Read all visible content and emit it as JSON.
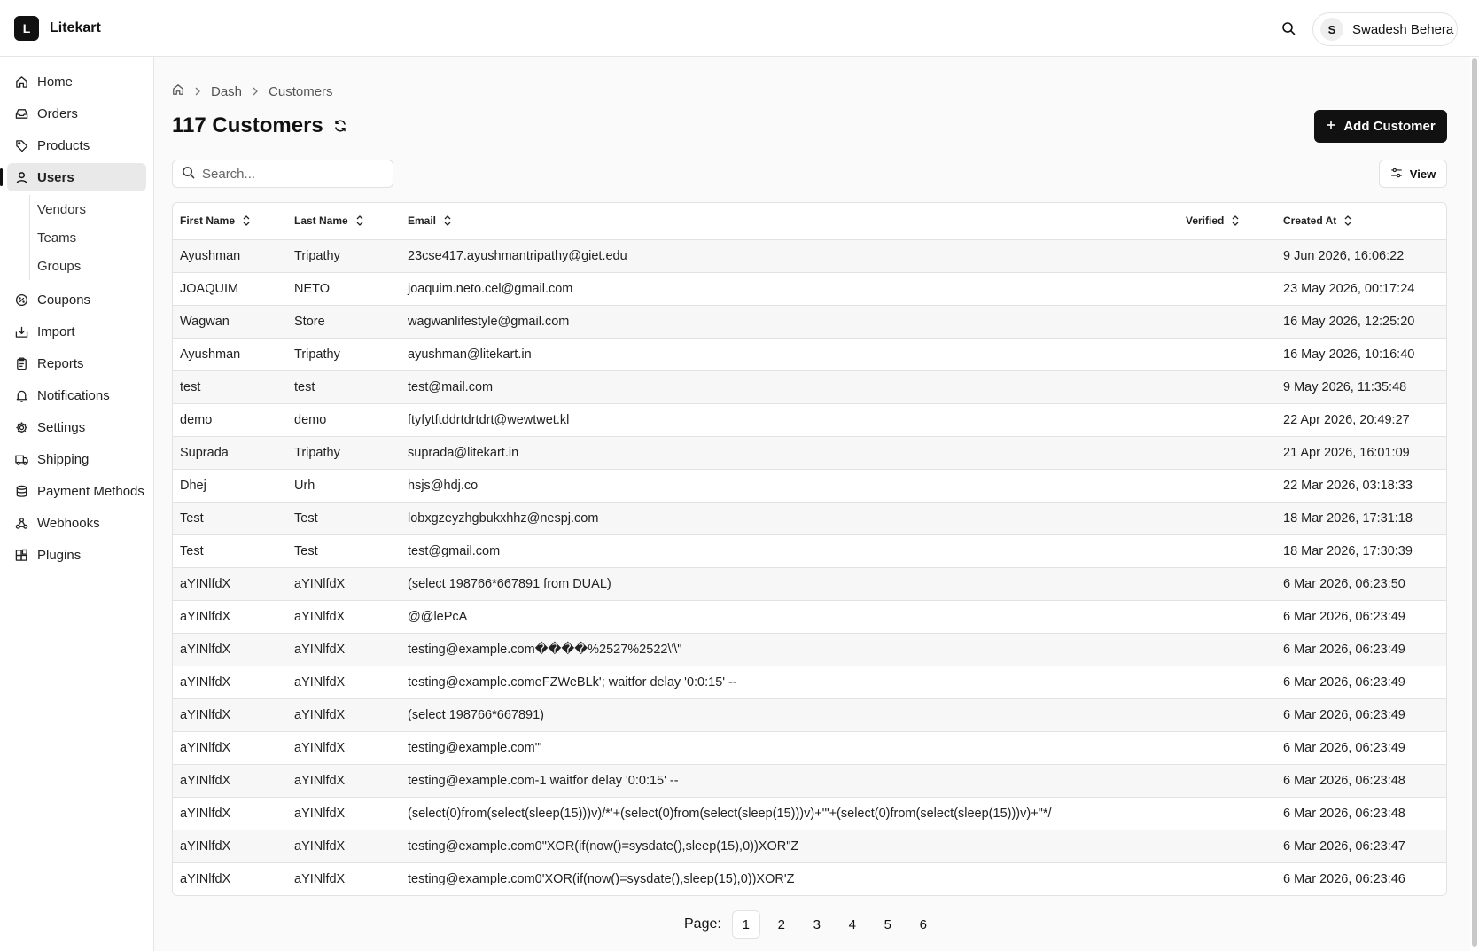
{
  "app": {
    "logo_letter": "L",
    "name": "Litekart"
  },
  "header": {
    "user_initial": "S",
    "user_name": "Swadesh Behera"
  },
  "sidebar": {
    "items": [
      {
        "label": "Home",
        "icon": "home-icon"
      },
      {
        "label": "Orders",
        "icon": "inbox-icon"
      },
      {
        "label": "Products",
        "icon": "tag-icon"
      },
      {
        "label": "Users",
        "icon": "user-icon",
        "active": true
      },
      {
        "label": "Coupons",
        "icon": "badge-percent-icon"
      },
      {
        "label": "Import",
        "icon": "import-icon"
      },
      {
        "label": "Reports",
        "icon": "clipboard-icon"
      },
      {
        "label": "Notifications",
        "icon": "bell-icon"
      },
      {
        "label": "Settings",
        "icon": "gear-icon"
      },
      {
        "label": "Shipping",
        "icon": "truck-icon"
      },
      {
        "label": "Payment Methods",
        "icon": "database-icon"
      },
      {
        "label": "Webhooks",
        "icon": "webhook-icon"
      },
      {
        "label": "Plugins",
        "icon": "blocks-icon"
      }
    ],
    "users_sub": [
      "Vendors",
      "Teams",
      "Groups"
    ]
  },
  "breadcrumb": {
    "items": [
      "Dash",
      "Customers"
    ]
  },
  "page": {
    "title": "117 Customers",
    "add_button": "Add Customer"
  },
  "search": {
    "placeholder": "Search..."
  },
  "view_button": "View",
  "table": {
    "columns": [
      "First Name",
      "Last Name",
      "Email",
      "Verified",
      "Created At"
    ],
    "rows": [
      [
        "Ayushman",
        "Tripathy",
        "23cse417.ayushmantripathy@giet.edu",
        "",
        "9 Jun 2026, 16:06:22"
      ],
      [
        "JOAQUIM",
        "NETO",
        "joaquim.neto.cel@gmail.com",
        "",
        "23 May 2026, 00:17:24"
      ],
      [
        "Wagwan",
        "Store",
        "wagwanlifestyle@gmail.com",
        "",
        "16 May 2026, 12:25:20"
      ],
      [
        "Ayushman",
        "Tripathy",
        "ayushman@litekart.in",
        "",
        "16 May 2026, 10:16:40"
      ],
      [
        "test",
        "test",
        "test@mail.com",
        "",
        "9 May 2026, 11:35:48"
      ],
      [
        "demo",
        "demo",
        "ftyfytftddrtdrtdrt@wewtwet.kl",
        "",
        "22 Apr 2026, 20:49:27"
      ],
      [
        "Suprada",
        "Tripathy",
        "suprada@litekart.in",
        "",
        "21 Apr 2026, 16:01:09"
      ],
      [
        "Dhej",
        "Urh",
        "hsjs@hdj.co",
        "",
        "22 Mar 2026, 03:18:33"
      ],
      [
        "Test",
        "Test",
        "lobxgzeyzhgbukxhhz@nespj.com",
        "",
        "18 Mar 2026, 17:31:18"
      ],
      [
        "Test",
        "Test",
        "test@gmail.com",
        "",
        "18 Mar 2026, 17:30:39"
      ],
      [
        "aYINlfdX",
        "aYINlfdX",
        "(select 198766*667891 from DUAL)",
        "",
        "6 Mar 2026, 06:23:50"
      ],
      [
        "aYINlfdX",
        "aYINlfdX",
        "@@lePcA",
        "",
        "6 Mar 2026, 06:23:49"
      ],
      [
        "aYINlfdX",
        "aYINlfdX",
        "testing@example.com����%2527%2522\\'\\\"",
        "",
        "6 Mar 2026, 06:23:49"
      ],
      [
        "aYINlfdX",
        "aYINlfdX",
        "testing@example.comeFZWeBLk'; waitfor delay '0:0:15' --",
        "",
        "6 Mar 2026, 06:23:49"
      ],
      [
        "aYINlfdX",
        "aYINlfdX",
        "(select 198766*667891)",
        "",
        "6 Mar 2026, 06:23:49"
      ],
      [
        "aYINlfdX",
        "aYINlfdX",
        "testing@example.com'\"",
        "",
        "6 Mar 2026, 06:23:49"
      ],
      [
        "aYINlfdX",
        "aYINlfdX",
        "testing@example.com-1 waitfor delay '0:0:15' --",
        "",
        "6 Mar 2026, 06:23:48"
      ],
      [
        "aYINlfdX",
        "aYINlfdX",
        "(select(0)from(select(sleep(15)))v)/*'+(select(0)from(select(sleep(15)))v)+'\"+(select(0)from(select(sleep(15)))v)+\"*/",
        "",
        "6 Mar 2026, 06:23:48"
      ],
      [
        "aYINlfdX",
        "aYINlfdX",
        "testing@example.com0\"XOR(if(now()=sysdate(),sleep(15),0))XOR\"Z",
        "",
        "6 Mar 2026, 06:23:47"
      ],
      [
        "aYINlfdX",
        "aYINlfdX",
        "testing@example.com0'XOR(if(now()=sysdate(),sleep(15),0))XOR'Z",
        "",
        "6 Mar 2026, 06:23:46"
      ]
    ]
  },
  "pagination": {
    "label": "Page:",
    "pages": [
      "1",
      "2",
      "3",
      "4",
      "5",
      "6"
    ],
    "current": "1"
  }
}
